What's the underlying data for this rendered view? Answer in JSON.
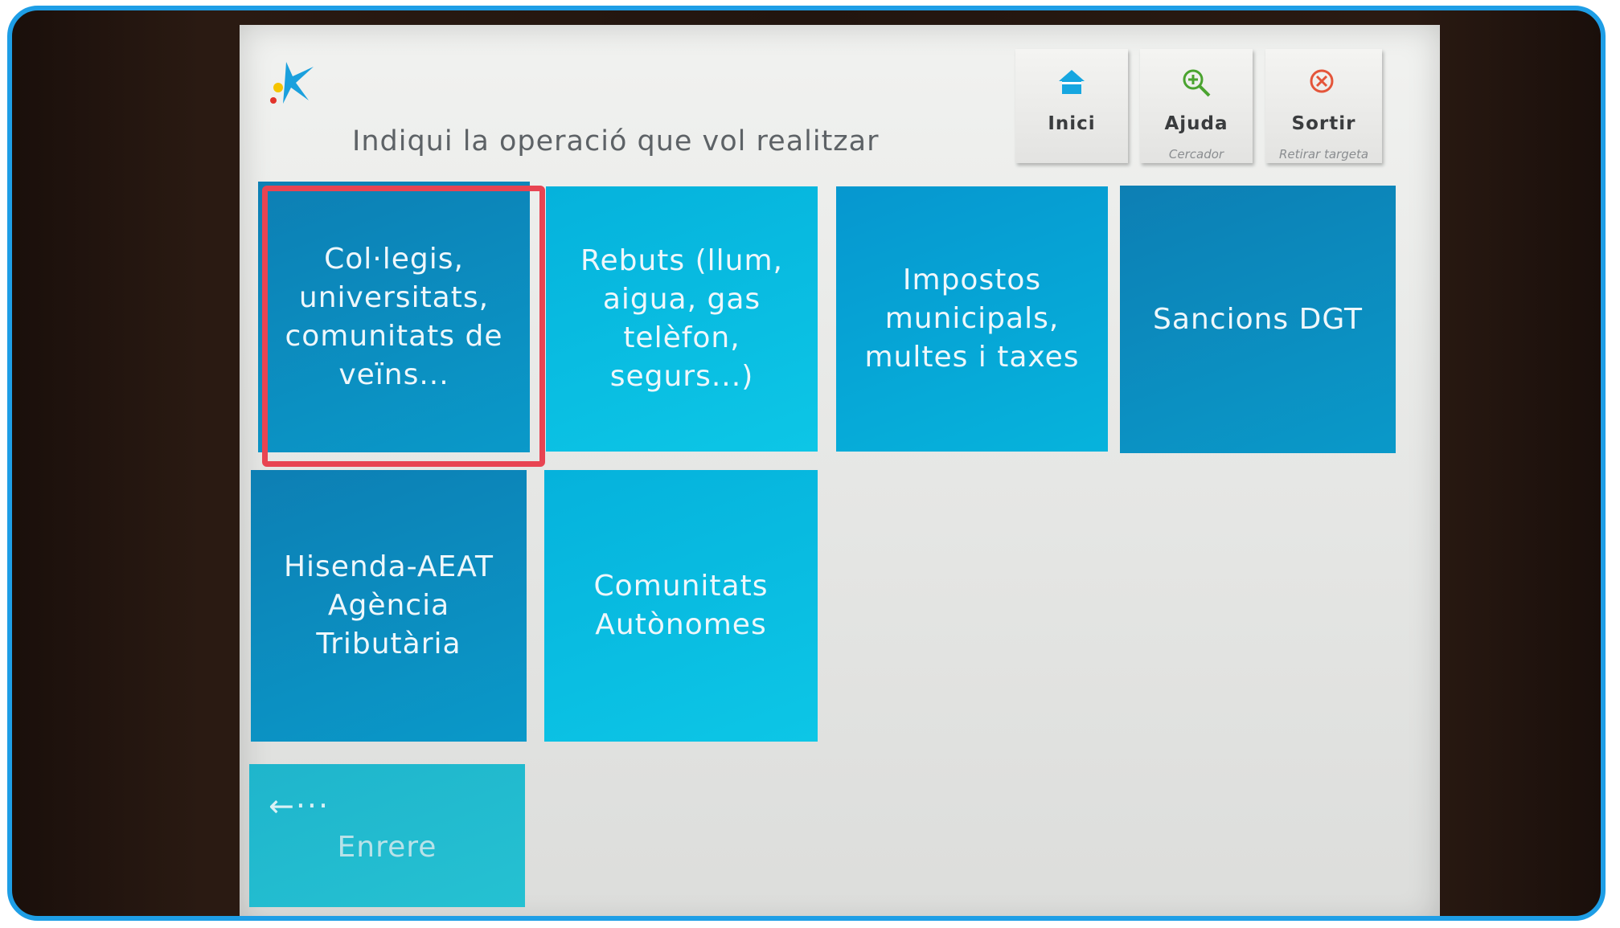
{
  "header": {
    "prompt": "Indiqui la operació que vol realitzar"
  },
  "top_buttons": {
    "home": {
      "label": "Inici",
      "icon": "home-icon"
    },
    "help": {
      "label": "Ajuda",
      "sub": "Cercador",
      "icon": "zoom-in-icon"
    },
    "exit": {
      "label": "Sortir",
      "sub": "Retirar targeta",
      "icon": "close-circle-icon"
    }
  },
  "tiles": [
    {
      "label": "Col·legis, universitats, comunitats de veïns..."
    },
    {
      "label": "Rebuts (llum, aigua, gas telèfon, segurs...)"
    },
    {
      "label": "Impostos municipals, multes i taxes"
    },
    {
      "label": "Sancions DGT"
    },
    {
      "label": "Hisenda-AEAT Agència Tributària"
    },
    {
      "label": "Comunitats Autònomes"
    }
  ],
  "back": {
    "arrow": "←···",
    "label": "Enrere"
  },
  "colors": {
    "frame_border": "#1e9ee6",
    "tile_blue": "#06b3dc",
    "highlight": "#e84452"
  }
}
